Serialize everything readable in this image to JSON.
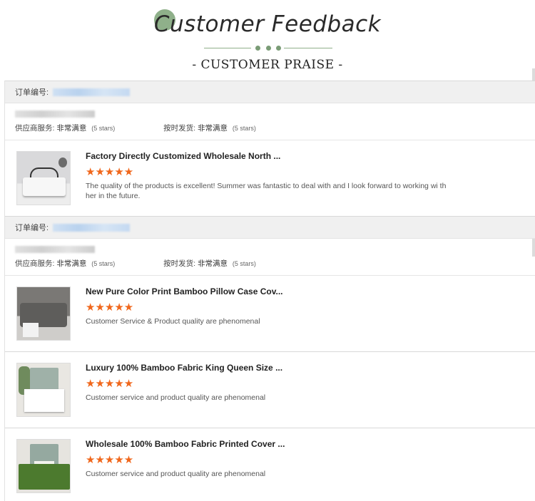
{
  "header": {
    "title": "Customer Feedback",
    "subtitle": "- CUSTOMER PRAISE -"
  },
  "orders": [
    {
      "order_label": "订单编号:",
      "supplier_service_label": "供应商服务:",
      "supplier_service_value": "非常满意",
      "supplier_service_stars": "(5 stars)",
      "shipping_label": "按时发货:",
      "shipping_value": "非常满意",
      "shipping_stars": "(5 stars)",
      "items": [
        {
          "title": "Factory Directly Customized Wholesale North ...",
          "stars": "★★★★★",
          "review": "The quality of the products is excellent! Summer was fantastic to deal with and I look forward to working wi th her in the future."
        }
      ]
    },
    {
      "order_label": "订单编号:",
      "supplier_service_label": "供应商服务:",
      "supplier_service_value": "非常满意",
      "supplier_service_stars": "(5 stars)",
      "shipping_label": "按时发货:",
      "shipping_value": "非常满意",
      "shipping_stars": "(5 stars)",
      "items": [
        {
          "title": "New Pure Color Print Bamboo Pillow Case Cov...",
          "stars": "★★★★★",
          "review": "Customer Service & Product quality are phenomenal"
        },
        {
          "title": "Luxury 100% Bamboo Fabric King Queen Size ...",
          "stars": "★★★★★",
          "review": "Customer service and product quality are phenomenal"
        },
        {
          "title": "Wholesale 100% Bamboo Fabric Printed Cover ...",
          "stars": "★★★★★",
          "review": "Customer service and product quality are phenomenal"
        }
      ]
    }
  ],
  "colors": {
    "accent_green": "#8fb08a",
    "star_orange": "#f0671c",
    "order_header_bg": "#f0f0f0"
  }
}
